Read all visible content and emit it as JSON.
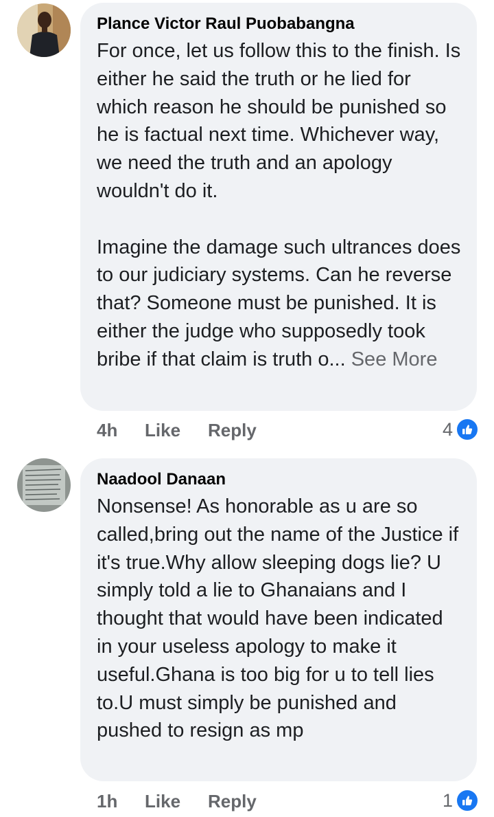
{
  "comments": [
    {
      "author": "Plance Victor Raul Puobabangna",
      "avatar_icon": "profile-photo-man",
      "paragraphs": [
        "For once, let us follow this to the finish. Is either he said the truth or he lied for which reason he should be punished so he is factual next time. Whichever way, we need the truth and an apology wouldn't do it.",
        "Imagine the damage such ultrances does to our judiciary systems. Can he reverse that? Someone must be punished. It is either the judge who supposedly took bribe if that claim is truth o..."
      ],
      "see_more": "See More",
      "time": "4h",
      "like_label": "Like",
      "reply_label": "Reply",
      "reaction_count": "4",
      "reaction_icon": "like-icon"
    },
    {
      "author": "Naadool Danaan",
      "avatar_icon": "profile-photo-document",
      "paragraphs": [
        "Nonsense! As honorable as u are so called,bring out the name of the Justice if it's true.Why allow sleeping dogs lie? U simply told a lie to Ghanaians and I thought that would have been indicated in your useless apology to make it useful.Ghana is too big for u to tell lies to.U must simply be punished and pushed to resign as mp"
      ],
      "time": "1h",
      "like_label": "Like",
      "reply_label": "Reply",
      "reaction_count": "1",
      "reaction_icon": "like-icon"
    }
  ],
  "colors": {
    "bubble": "#f0f2f5",
    "meta_text": "#65676b",
    "like_blue": "#1877f2"
  }
}
